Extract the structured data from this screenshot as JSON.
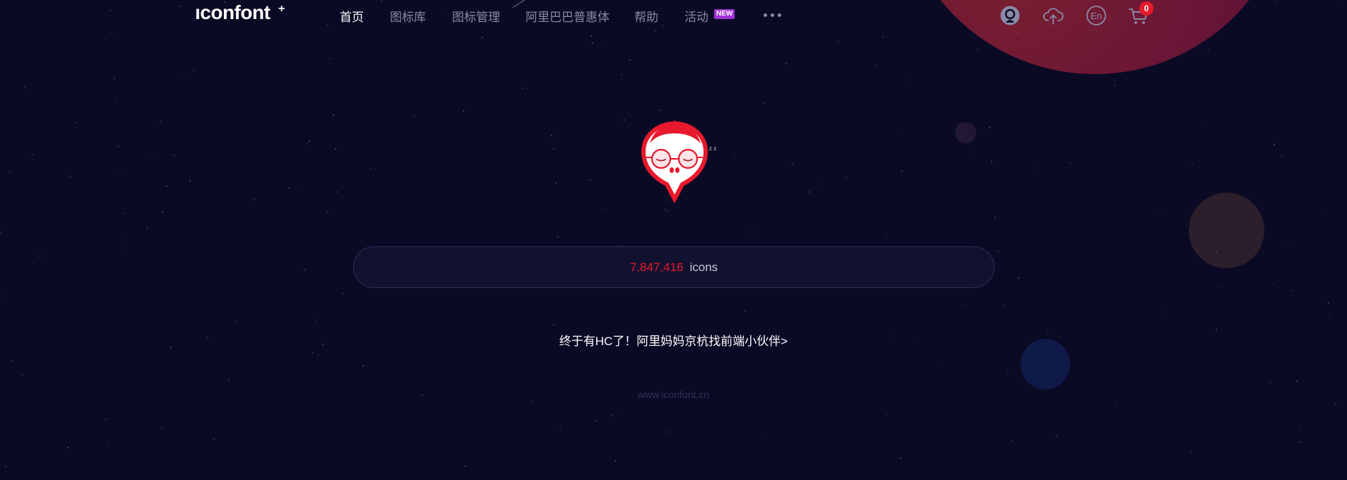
{
  "brand": {
    "logo_text": "ıconfont",
    "logo_plus": "+"
  },
  "nav": {
    "items": [
      {
        "label": "首页",
        "active": true
      },
      {
        "label": "图标库"
      },
      {
        "label": "图标管理"
      },
      {
        "label": "阿里巴巴普惠体"
      },
      {
        "label": "帮助"
      },
      {
        "label": "活动"
      }
    ],
    "new_badge": "NEW",
    "more_icon": "more-dots-icon"
  },
  "header_icons": {
    "user": "user-avatar-icon",
    "upload": "cloud-upload-icon",
    "language": "language-en-icon",
    "language_text": "En",
    "cart": "shopping-cart-icon",
    "cart_count": "0"
  },
  "hero": {
    "mascot": "sleeping-mascot",
    "mascot_zz": "z z"
  },
  "search": {
    "icon_count": "7,847,416",
    "icon_unit": "icons"
  },
  "promo": {
    "text": "终于有HC了！阿里妈妈京杭找前端小伙伴>"
  },
  "footer": {
    "url": "www.iconfont.cn"
  },
  "colors": {
    "background": "#0b0a25",
    "accent_red": "#e8192c",
    "badge_purple": "#a232d8",
    "nav_text": "#8a8aa6"
  }
}
